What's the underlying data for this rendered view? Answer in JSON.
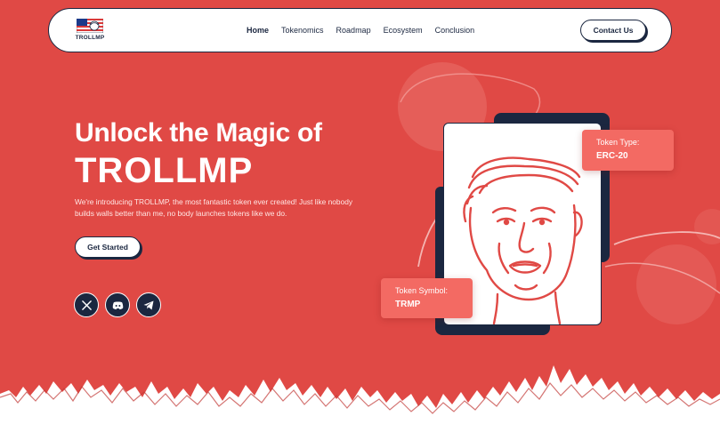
{
  "brand": {
    "logo_text": "TROLLMP"
  },
  "nav": {
    "links": [
      {
        "label": "Home",
        "active": true
      },
      {
        "label": "Tokenomics"
      },
      {
        "label": "Roadmap"
      },
      {
        "label": "Ecosystem"
      },
      {
        "label": "Conclusion"
      }
    ],
    "cta_label": "Contact Us"
  },
  "hero": {
    "title_line1": "Unlock the Magic of",
    "title_line2": "TROLLMP",
    "description": "We're introducing TROLLMP, the most fantastic token ever created! Just like nobody builds walls better than me, no body launches tokens like we do.",
    "button_label": "Get Started"
  },
  "socials": [
    {
      "icon": "x-icon"
    },
    {
      "icon": "discord-icon"
    },
    {
      "icon": "telegram-icon"
    }
  ],
  "token": {
    "type_label": "Token Type:",
    "type_value": "ERC-20",
    "symbol_label": "Token Symbol:",
    "symbol_value": "TRMP"
  },
  "colors": {
    "background": "#e04945",
    "navy": "#1b2740",
    "card_badge": "#f36a63",
    "white": "#ffffff"
  }
}
